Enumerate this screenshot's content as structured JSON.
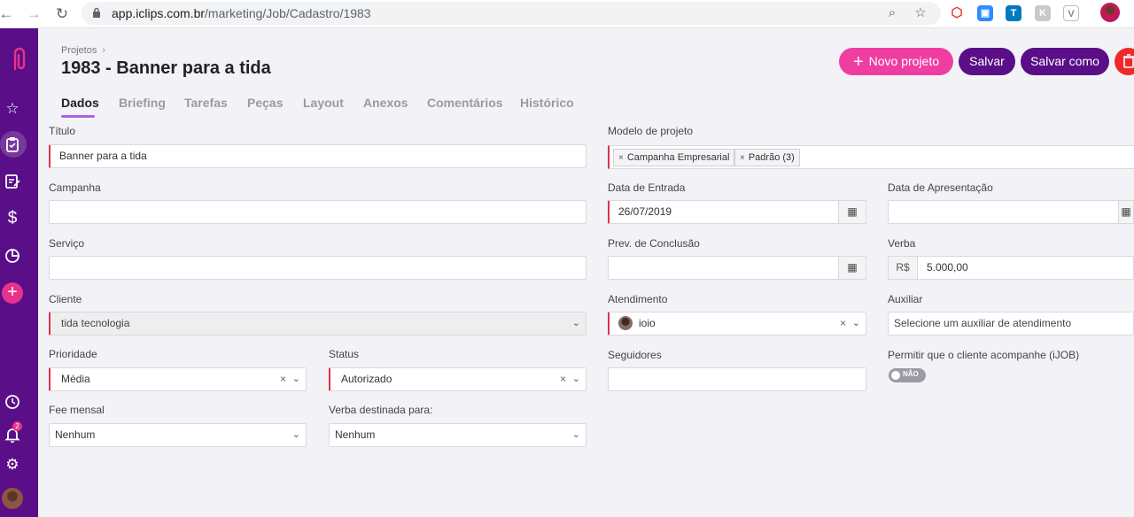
{
  "browser": {
    "url_host": "app.iclips.com.br",
    "url_path": "/marketing/Job/Cadastro/1983"
  },
  "sidebar": {
    "notifications_count": "2"
  },
  "header": {
    "breadcrumb": "Projetos",
    "title": "1983 - Banner para a tida",
    "new_project_label": "Novo projeto",
    "save_label": "Salvar",
    "save_as_label": "Salvar como"
  },
  "tabs": [
    {
      "label": "Dados"
    },
    {
      "label": "Briefing"
    },
    {
      "label": "Tarefas"
    },
    {
      "label": "Peças"
    },
    {
      "label": "Layout"
    },
    {
      "label": "Anexos"
    },
    {
      "label": "Comentários"
    },
    {
      "label": "Histórico"
    }
  ],
  "form": {
    "titulo": {
      "label": "Título",
      "value": "Banner para a tida"
    },
    "campanha": {
      "label": "Campanha",
      "value": ""
    },
    "servico": {
      "label": "Serviço",
      "value": ""
    },
    "cliente": {
      "label": "Cliente",
      "value": "tida tecnologia"
    },
    "prioridade": {
      "label": "Prioridade",
      "value": "Média"
    },
    "status": {
      "label": "Status",
      "value": "Autorizado"
    },
    "fee_mensal": {
      "label": "Fee mensal",
      "value": "Nenhum"
    },
    "verba_destinada": {
      "label": "Verba destinada para:",
      "value": "Nenhum"
    },
    "modelo": {
      "label": "Modelo de projeto",
      "tags": [
        "Campanha Empresarial",
        "Padrão (3)"
      ]
    },
    "data_entrada": {
      "label": "Data de Entrada",
      "value": "26/07/2019"
    },
    "data_apresentacao": {
      "label": "Data de Apresentação",
      "value": ""
    },
    "prev_conclusao": {
      "label": "Prev. de Conclusão",
      "value": ""
    },
    "verba": {
      "label": "Verba",
      "currency": "R$",
      "value": "5.000,00"
    },
    "atendimento": {
      "label": "Atendimento",
      "value": "ioio"
    },
    "auxiliar": {
      "label": "Auxiliar",
      "placeholder": "Selecione um auxiliar de atendimento"
    },
    "seguidores": {
      "label": "Seguidores",
      "value": ""
    },
    "permitir": {
      "label": "Permitir que o cliente acompanhe (iJOB)",
      "toggle_label": "NÃO",
      "enabled": false
    }
  },
  "colors": {
    "sidebar": "#5a0e87",
    "primary_pink": "#ef3ea2",
    "danger": "#ee2a2a",
    "required_marker": "#d9334d"
  }
}
